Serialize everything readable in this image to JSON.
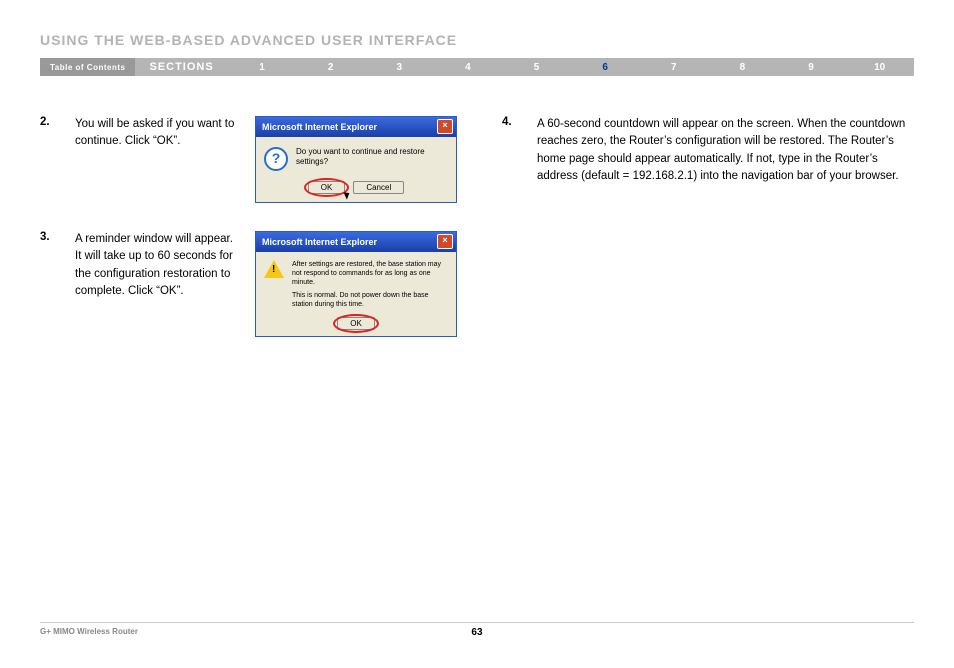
{
  "heading": "USING THE WEB-BASED ADVANCED USER INTERFACE",
  "nav": {
    "toc": "Table of Contents",
    "sections_label": "SECTIONS",
    "items": [
      "1",
      "2",
      "3",
      "4",
      "5",
      "6",
      "7",
      "8",
      "9",
      "10"
    ],
    "active_index": 5
  },
  "steps": {
    "s2": {
      "num": "2.",
      "text": "You will be asked if you want to continue. Click “OK”."
    },
    "s3": {
      "num": "3.",
      "text": "A reminder window will appear. It will take up to 60 seconds for the configuration restoration to complete. Click “OK”."
    },
    "s4": {
      "num": "4.",
      "text": "A 60-second countdown will appear on the screen. When the countdown reaches zero, the Router’s configuration will be restored. The Router’s home page should appear automatically. If not, type in the Router’s address (default = 192.168.2.1) into the navigation bar of your browser."
    }
  },
  "dialog1": {
    "title": "Microsoft Internet Explorer",
    "message": "Do you want to continue and restore settings?",
    "ok": "OK",
    "cancel": "Cancel"
  },
  "dialog2": {
    "title": "Microsoft Internet Explorer",
    "line1": "After settings are restored, the base station may not respond to commands for as long as one minute.",
    "line2": "This is normal. Do not power down the base station during this time.",
    "ok": "OK"
  },
  "footer": {
    "product": "G+ MIMO Wireless Router",
    "page": "63"
  }
}
